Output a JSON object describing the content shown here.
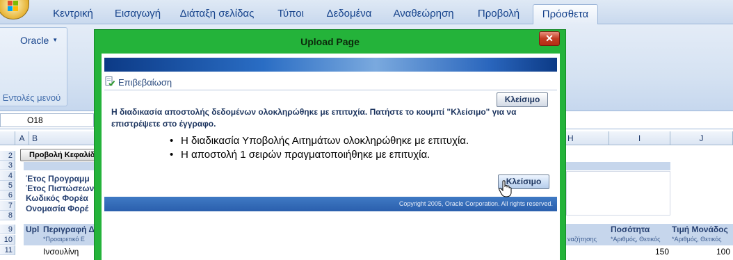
{
  "ribbon": {
    "tabs": [
      {
        "label": "Κεντρική"
      },
      {
        "label": "Εισαγωγή"
      },
      {
        "label": "Διάταξη σελίδας"
      },
      {
        "label": "Τύποι"
      },
      {
        "label": "Δεδομένα"
      },
      {
        "label": "Αναθεώρηση"
      },
      {
        "label": "Προβολή"
      },
      {
        "label": "Πρόσθετα"
      }
    ],
    "active_tab": "Πρόσθετα",
    "oracle_menu": "Oracle",
    "group_label": "Εντολές μενού"
  },
  "formula_bar": {
    "name_box": "O18"
  },
  "sheet": {
    "columns": [
      "A",
      "B",
      "H",
      "I",
      "J"
    ],
    "rows": [
      "2",
      "3",
      "4",
      "5",
      "6",
      "7",
      "8",
      "9",
      "10",
      "11"
    ],
    "header_button": "Προβολή Κεφαλίδ",
    "labels": [
      "Έτος Προγραμμ",
      "Έτος Πιστώσεων",
      "Κωδικός Φορέα",
      "Ονομασία Φορέ"
    ],
    "table_headers": {
      "upl": "Upl",
      "description": "Περιγραφή Δ",
      "description_hint": "*Προαιρετικό Ε",
      "search_hint": "ναζήτησης",
      "quantity": "Ποσότητα",
      "quantity_hint": "*Αριθμός, Θετικός",
      "unit_price": "Τιμή Μονάδος",
      "unit_price_hint": "*Αριθμός, Θετικός"
    },
    "row11": {
      "description": "Ινσουλίνη",
      "quantity": "150",
      "unit_price": "100"
    }
  },
  "dialog": {
    "title": "Upload Page",
    "close_glyph": "✕",
    "section_title": "Επιβεβαίωση",
    "close_button": "Κλείσιμο",
    "message": "Η διαδικασία αποστολής δεδομένων ολοκληρώθηκε με επιτυχία. Πατήστε το κουμπί \"Κλείσιμο\" για να επιστρέψετε στο έγγραφο.",
    "bullets": [
      "Η διαδικασία Υποβολής Αιτημάτων ολοκληρώθηκε με επιτυχία.",
      "Η αποστολή 1 σειρών πραγματοποιήθηκε με επιτυχία."
    ],
    "copyright": "Copyright 2005, Oracle Corporation. All rights reserved."
  },
  "colors": {
    "dialog_frame": "#24b33a",
    "ribbon_text": "#15428b",
    "oracle_blue": "#2b5fad"
  }
}
